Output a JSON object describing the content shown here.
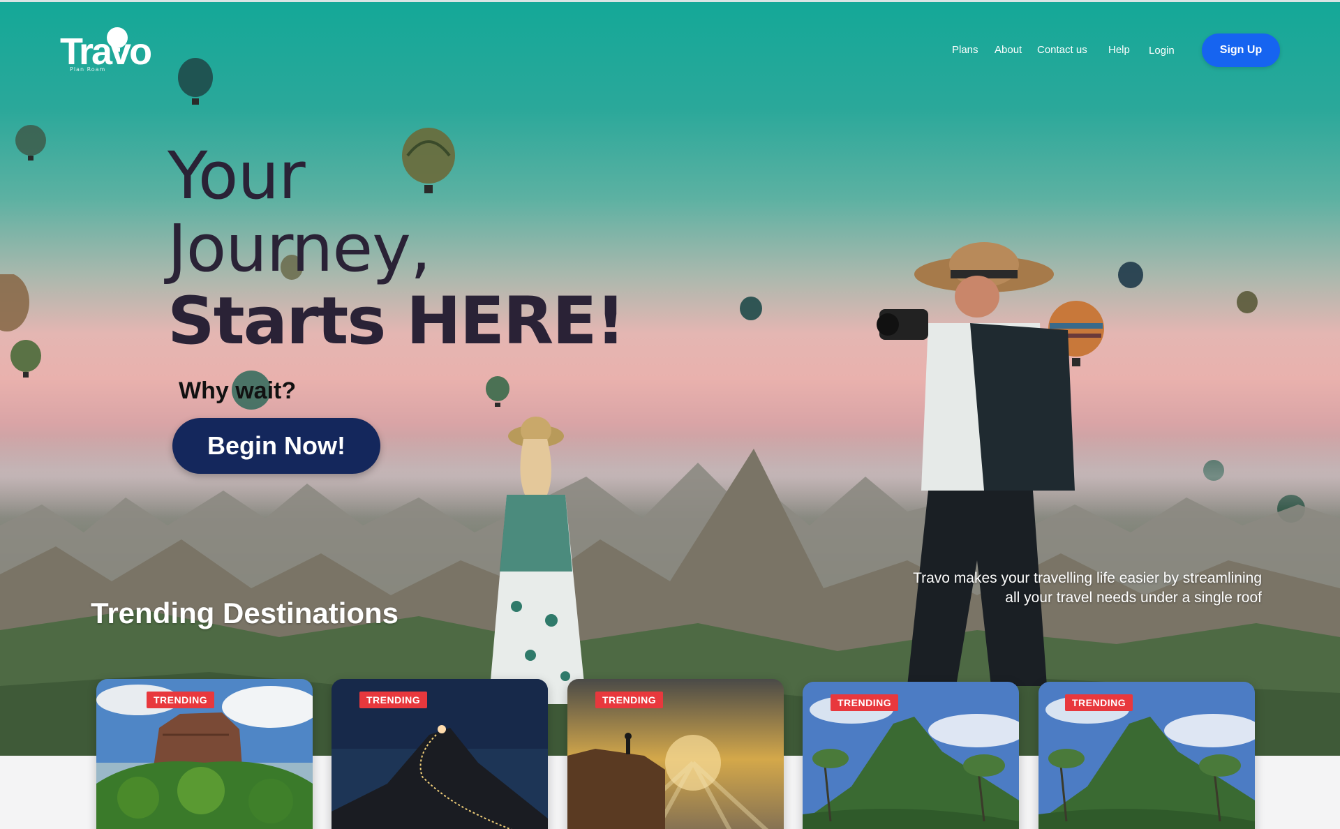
{
  "brand": {
    "logo_text": "Travo",
    "logo_tagline": "Plan Roam"
  },
  "nav": {
    "items": [
      "Plans",
      "About",
      "Contact us",
      "Help",
      "Login"
    ],
    "signup_label": "Sign Up"
  },
  "hero": {
    "headline_line1": "Your",
    "headline_line2": "Journey,",
    "headline_line3": "Starts HERE!",
    "subheading": "Why wait?",
    "cta_label": "Begin Now!",
    "tagline_line1": "Travo makes your travelling life easier by streamlining",
    "tagline_line2": "all your travel needs under a single roof"
  },
  "trending": {
    "title": "Trending Destinations",
    "cards": [
      {
        "badge": "TRENDING",
        "scene": "rock-fortress"
      },
      {
        "badge": "TRENDING",
        "scene": "night-peak"
      },
      {
        "badge": "TRENDING",
        "scene": "sunset-cliff"
      },
      {
        "badge": "TRENDING",
        "scene": "green-mountain"
      },
      {
        "badge": "TRENDING",
        "scene": "green-mountain"
      }
    ]
  },
  "colors": {
    "accent_blue": "#1664f0",
    "cta_navy": "#14275c",
    "badge_red": "#e8383d",
    "headline_dark": "#2a2236"
  }
}
